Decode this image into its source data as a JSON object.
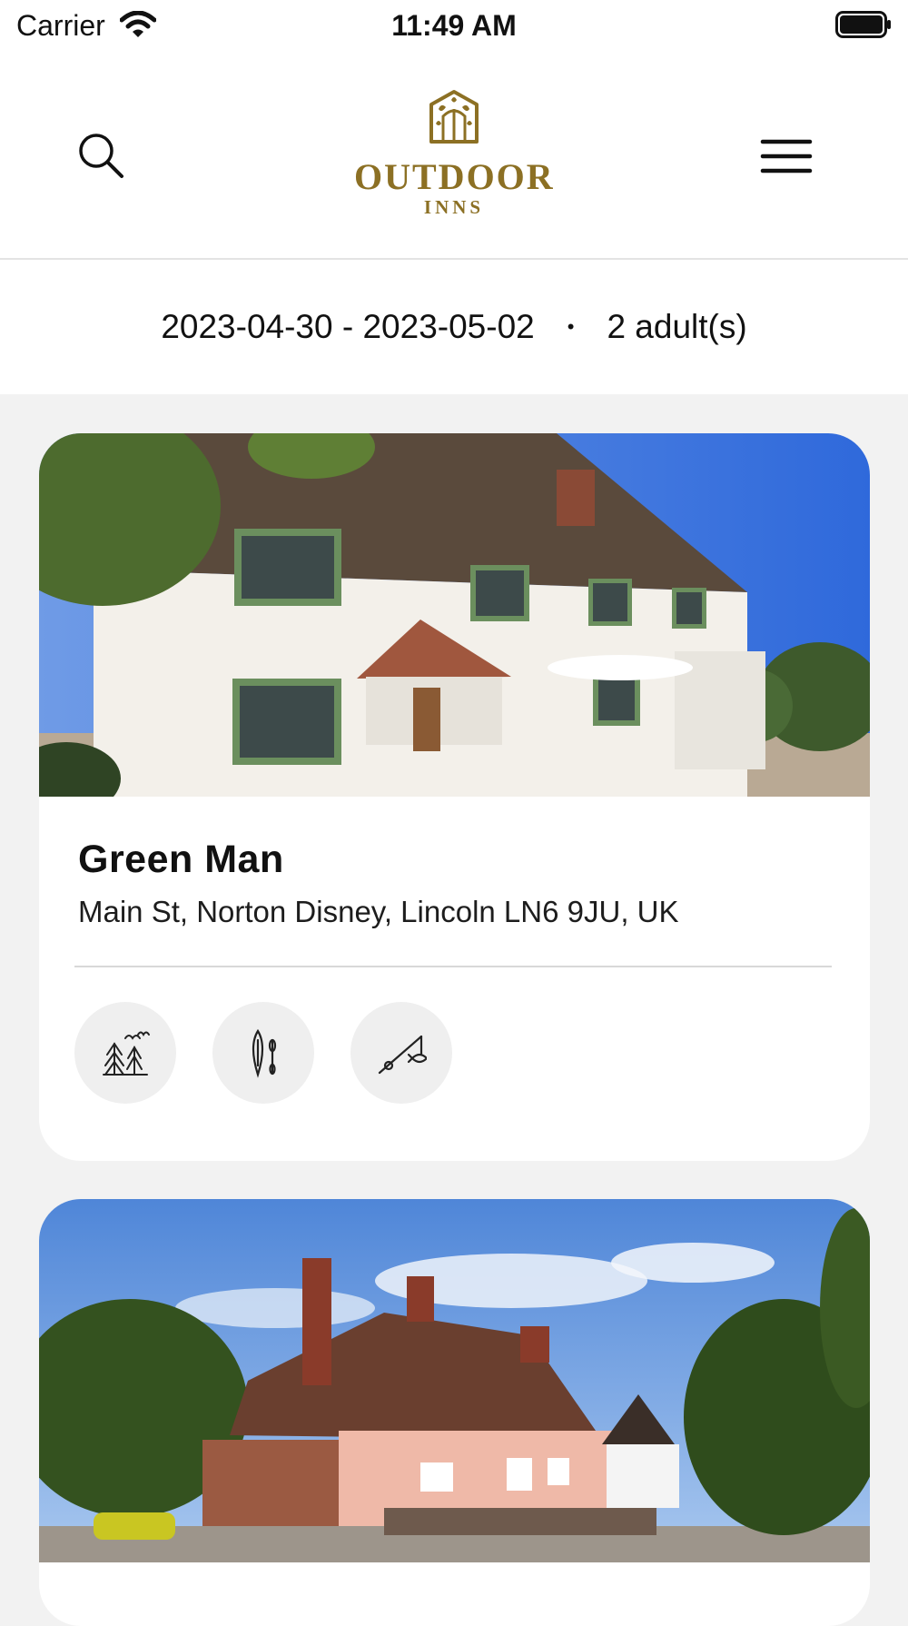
{
  "status_bar": {
    "carrier": "Carrier",
    "time": "11:49 AM",
    "wifi_icon": "wifi-icon",
    "battery_icon": "battery-full-icon"
  },
  "header": {
    "search_icon": "search-icon",
    "menu_icon": "hamburger-menu-icon",
    "logo": {
      "line1": "OUTDOOR",
      "line2": "INNS",
      "color": "#8c7024"
    }
  },
  "booking": {
    "dates": "2023-04-30 - 2023-05-02",
    "separator": "•",
    "guests": "2 adult(s)"
  },
  "inns": [
    {
      "name": "Green Man",
      "address": "Main St, Norton Disney, Lincoln LN6 9JU, UK",
      "activities": [
        "forest-birdwatching-icon",
        "canoe-paddle-icon",
        "fishing-rod-icon"
      ]
    },
    {
      "name": "",
      "address": "",
      "activities": []
    }
  ]
}
